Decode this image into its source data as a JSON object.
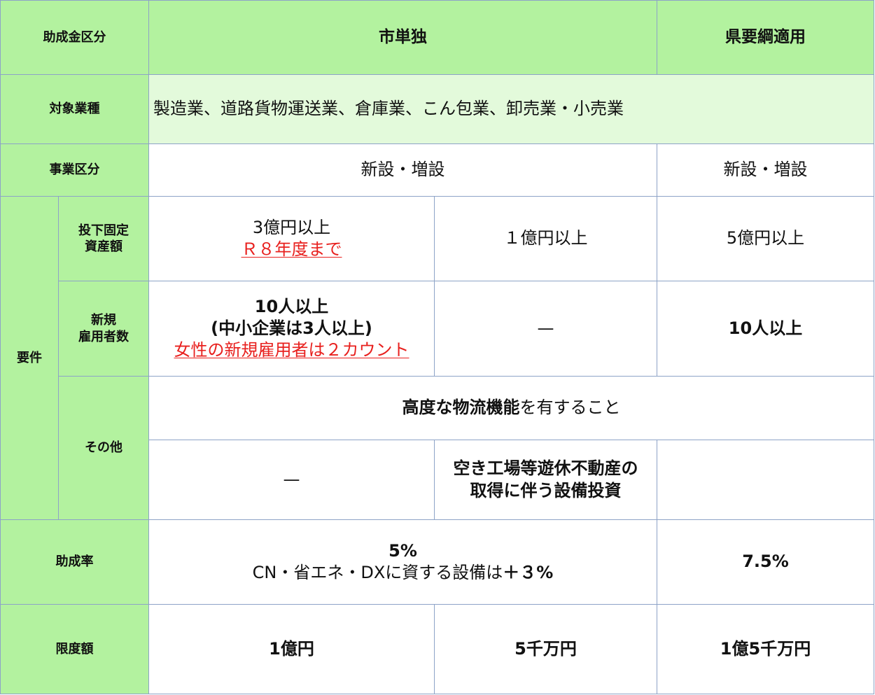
{
  "header": {
    "category_label": "助成金区分",
    "city_only": "市単独",
    "prefecture": "県要綱適用"
  },
  "industry": {
    "label": "対象業種",
    "value": "製造業、道路貨物運送業、倉庫業、こん包業、卸売業・小売業"
  },
  "business": {
    "label": "事業区分",
    "city": "新設・増設",
    "pref": "新設・増設"
  },
  "requirements": {
    "label": "要件",
    "assets": {
      "label_line1": "投下固定",
      "label_line2": "資産額",
      "c1_line1": "3億円以上",
      "c1_note": "Ｒ８年度まで",
      "c2": "１億円以上",
      "c3": "5億円以上"
    },
    "employment": {
      "label_line1": "新規",
      "label_line2": "雇用者数",
      "c1_line1": "10人以上",
      "c1_line2": "(中小企業は3人以上)",
      "c1_note": "女性の新規雇用者は２カウント",
      "c2": "—",
      "c3": "10人以上"
    },
    "other": {
      "label": "その他",
      "row1_bold": "高度な物流機能",
      "row1_rest": "を有すること",
      "row2_c1": "—",
      "row2_c2_line1": "空き工場等遊休不動産の",
      "row2_c2_line2": "取得に伴う設備投資",
      "row2_c3": ""
    }
  },
  "rate": {
    "label": "助成率",
    "city_line1": "5%",
    "city_line2_prefix": "CN・省エネ・DXに資する設備は",
    "city_line2_bold": "＋３%",
    "pref": "7.5%"
  },
  "limit": {
    "label": "限度額",
    "c1": "1億円",
    "c2": "5千万円",
    "c3": "1億5千万円"
  },
  "colors": {
    "header_green": "#b3f29f",
    "light_green": "#e3fadb",
    "border_blue": "#8da3c7",
    "note_red": "#e8201e"
  }
}
